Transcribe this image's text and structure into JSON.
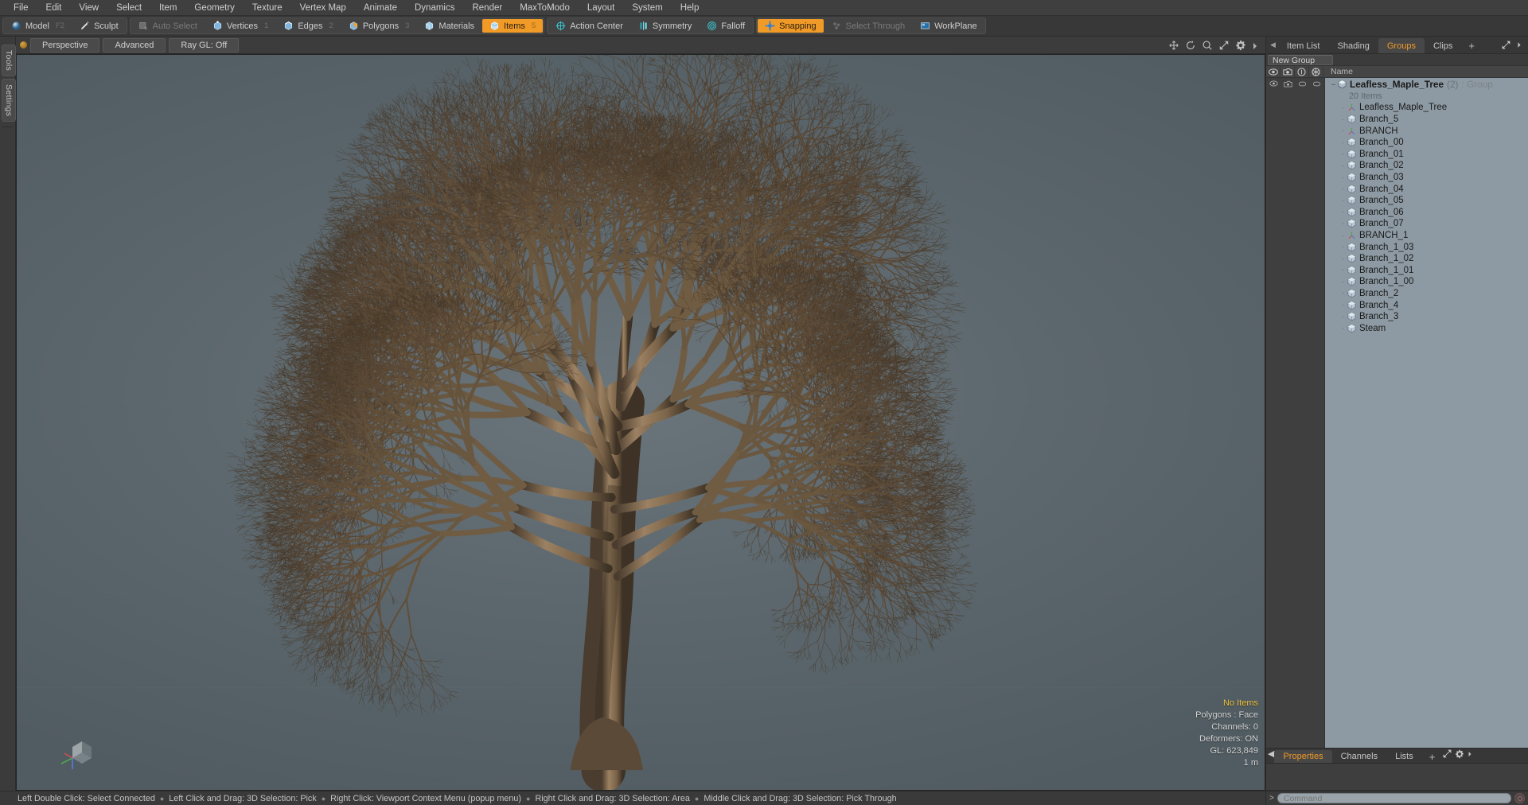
{
  "menubar": {
    "items": [
      {
        "label": "File"
      },
      {
        "label": "Edit"
      },
      {
        "label": "View"
      },
      {
        "label": "Select"
      },
      {
        "label": "Item"
      },
      {
        "label": "Geometry"
      },
      {
        "label": "Texture"
      },
      {
        "label": "Vertex Map"
      },
      {
        "label": "Animate"
      },
      {
        "label": "Dynamics"
      },
      {
        "label": "Render"
      },
      {
        "label": "MaxToModo"
      },
      {
        "label": "Layout"
      },
      {
        "label": "System"
      },
      {
        "label": "Help"
      }
    ]
  },
  "toolbar": {
    "group_mode": [
      {
        "label": "Model",
        "icon": "sphere-icon",
        "shortcut": "F2",
        "state": "normal"
      },
      {
        "label": "Sculpt",
        "icon": "brush-icon",
        "shortcut": "",
        "state": "normal"
      }
    ],
    "group_select": [
      {
        "label": "Auto Select",
        "icon": "auto-select-icon",
        "shortcut": "",
        "state": "disabled"
      },
      {
        "label": "Vertices",
        "icon": "vertices-icon",
        "shortcut": "1",
        "state": "normal"
      },
      {
        "label": "Edges",
        "icon": "edges-icon",
        "shortcut": "2",
        "state": "normal"
      },
      {
        "label": "Polygons",
        "icon": "polygons-icon",
        "shortcut": "3",
        "state": "normal"
      },
      {
        "label": "Materials",
        "icon": "materials-icon",
        "shortcut": "",
        "state": "normal"
      },
      {
        "label": "Items",
        "icon": "items-icon",
        "shortcut": "5",
        "state": "active"
      }
    ],
    "group_action": [
      {
        "label": "Action Center",
        "icon": "action-center-icon",
        "state": "normal"
      },
      {
        "label": "Symmetry",
        "icon": "symmetry-icon",
        "state": "normal"
      },
      {
        "label": "Falloff",
        "icon": "falloff-icon",
        "state": "normal"
      }
    ],
    "group_snap": [
      {
        "label": "Snapping",
        "icon": "snapping-icon",
        "state": "active"
      },
      {
        "label": "Select Through",
        "icon": "select-through-icon",
        "state": "disabled"
      },
      {
        "label": "WorkPlane",
        "icon": "workplane-icon",
        "state": "normal"
      }
    ]
  },
  "left_tabs": [
    {
      "label": "Tools"
    },
    {
      "label": "Settings"
    }
  ],
  "viewport": {
    "view_mode": "Perspective",
    "shading_mode": "Advanced",
    "raygl": "Ray GL: Off",
    "icons": [
      "move-icon",
      "rotate-icon",
      "zoom-icon",
      "fit-icon",
      "gear-icon",
      "chevron-right-icon"
    ],
    "stats": {
      "selection": "No Items",
      "polygons": "Polygons : Face",
      "channels": "Channels: 0",
      "deformers": "Deformers: ON",
      "gl": "GL: 623,849",
      "scale": "1 m"
    }
  },
  "right_panel": {
    "tabs": [
      {
        "label": "Item List",
        "active": false
      },
      {
        "label": "Shading",
        "active": false
      },
      {
        "label": "Groups",
        "active": true
      },
      {
        "label": "Clips",
        "active": false
      },
      {
        "label": "+",
        "active": false
      }
    ],
    "new_group_button": "New Group",
    "list_header": {
      "columns": [
        "eye-icon",
        "render-icon",
        "lock-icon",
        "wireframe-icon"
      ],
      "name": "Name"
    },
    "tree": [
      {
        "label": "Leafless_Maple_Tree",
        "count": "(2)",
        "suffix": ": Group",
        "icon": "group-icon",
        "level": 0,
        "kind": "group"
      },
      {
        "label": "20 Items",
        "icon": "",
        "level": 1,
        "kind": "info"
      },
      {
        "label": "Leafless_Maple_Tree",
        "icon": "locator-icon",
        "level": 1,
        "kind": "locator"
      },
      {
        "label": "Branch_5",
        "icon": "mesh-icon",
        "level": 1,
        "kind": "mesh"
      },
      {
        "label": "BRANCH",
        "icon": "locator-icon",
        "level": 1,
        "kind": "locator"
      },
      {
        "label": "Branch_00",
        "icon": "mesh-icon",
        "level": 1,
        "kind": "mesh"
      },
      {
        "label": "Branch_01",
        "icon": "mesh-icon",
        "level": 1,
        "kind": "mesh"
      },
      {
        "label": "Branch_02",
        "icon": "mesh-icon",
        "level": 1,
        "kind": "mesh"
      },
      {
        "label": "Branch_03",
        "icon": "mesh-icon",
        "level": 1,
        "kind": "mesh"
      },
      {
        "label": "Branch_04",
        "icon": "mesh-icon",
        "level": 1,
        "kind": "mesh"
      },
      {
        "label": "Branch_05",
        "icon": "mesh-icon",
        "level": 1,
        "kind": "mesh"
      },
      {
        "label": "Branch_06",
        "icon": "mesh-icon",
        "level": 1,
        "kind": "mesh"
      },
      {
        "label": "Branch_07",
        "icon": "mesh-icon",
        "level": 1,
        "kind": "mesh"
      },
      {
        "label": "BRANCH_1",
        "icon": "locator-icon",
        "level": 1,
        "kind": "locator"
      },
      {
        "label": "Branch_1_03",
        "icon": "mesh-icon",
        "level": 1,
        "kind": "mesh"
      },
      {
        "label": "Branch_1_02",
        "icon": "mesh-icon",
        "level": 1,
        "kind": "mesh"
      },
      {
        "label": "Branch_1_01",
        "icon": "mesh-icon",
        "level": 1,
        "kind": "mesh"
      },
      {
        "label": "Branch_1_00",
        "icon": "mesh-icon",
        "level": 1,
        "kind": "mesh"
      },
      {
        "label": "Branch_2",
        "icon": "mesh-icon",
        "level": 1,
        "kind": "mesh"
      },
      {
        "label": "Branch_4",
        "icon": "mesh-icon",
        "level": 1,
        "kind": "mesh"
      },
      {
        "label": "Branch_3",
        "icon": "mesh-icon",
        "level": 1,
        "kind": "mesh"
      },
      {
        "label": "Steam",
        "icon": "mesh-icon",
        "level": 1,
        "kind": "mesh"
      }
    ],
    "bottom_tabs": [
      {
        "label": "Properties",
        "active": true
      },
      {
        "label": "Channels",
        "active": false
      },
      {
        "label": "Lists",
        "active": false
      },
      {
        "label": "+",
        "active": false
      }
    ]
  },
  "command_bar": {
    "prompt": ">",
    "placeholder": "Command",
    "record_icon": "record-icon"
  },
  "statusbar": {
    "hints": [
      "Left Double Click: Select Connected",
      "Left Click and Drag: 3D Selection: Pick",
      "Right Click: Viewport Context Menu (popup menu)",
      "Right Click and Drag: 3D Selection: Area",
      "Middle Click and Drag: 3D Selection: Pick Through"
    ]
  },
  "colors": {
    "accent": "#f09a28",
    "panel": "#3b3b3b",
    "viewport_bg": "#5e6a70",
    "tree_bg": "#8d9aa3",
    "status_highlight": "#f0c23a"
  }
}
